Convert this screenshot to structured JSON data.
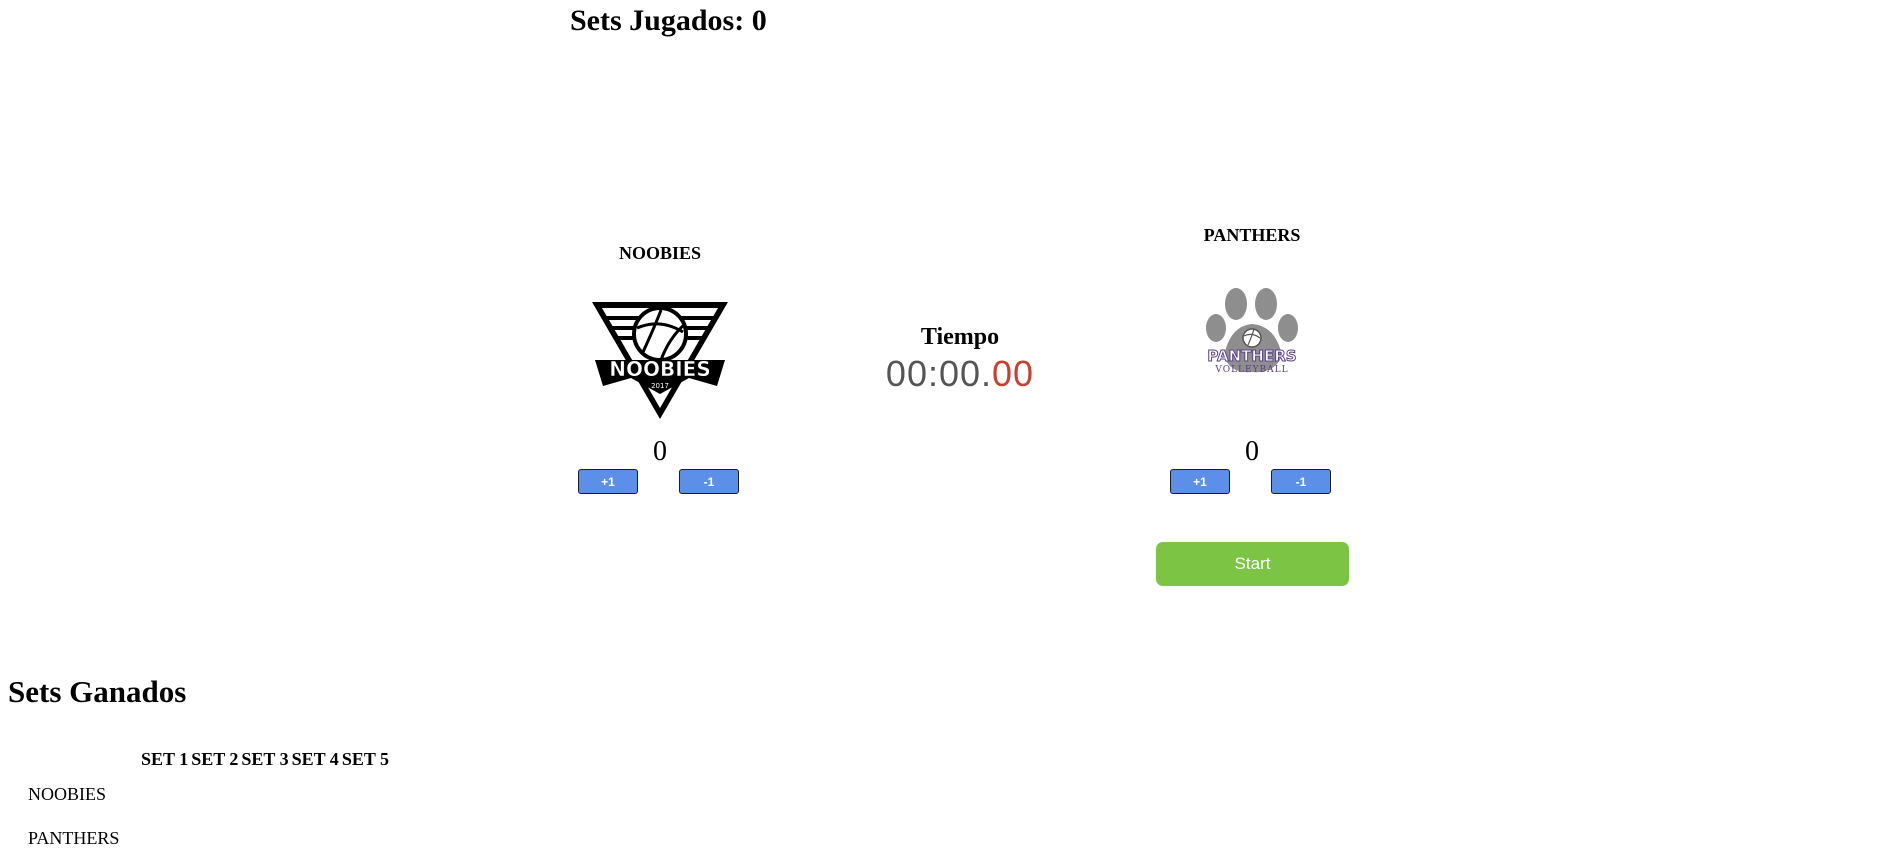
{
  "header": {
    "sets_played_label": "Sets Jugados:",
    "sets_played_value": "0"
  },
  "teams": {
    "left": {
      "name": "NOOBIES",
      "score": "0",
      "logo_text": "NOOBIES",
      "logo_year": "2017",
      "plus_label": "+1",
      "minus_label": "-1",
      "logo_icon": "volleyball-triangle-logo"
    },
    "right": {
      "name": "PANTHERS",
      "score": "0",
      "logo_text": "PANTHERS",
      "logo_subtext": "VOLLEYBALL",
      "plus_label": "+1",
      "minus_label": "-1",
      "logo_icon": "paw-print-logo"
    }
  },
  "timer": {
    "label": "Tiempo",
    "minutes_seconds": "00:00.",
    "hundredths": "00",
    "digit_color": "#555555",
    "hundredths_color": "#c9402f"
  },
  "controls": {
    "start_label": "Start",
    "start_color": "#7cc444",
    "score_button_color": "#5b8fe8"
  },
  "sets_won": {
    "title": "Sets Ganados",
    "columns": [
      "SET 1",
      "SET 2",
      "SET 3",
      "SET 4",
      "SET 5"
    ],
    "rows": [
      {
        "team": "NOOBIES",
        "sets": [
          "",
          "",
          "",
          "",
          ""
        ]
      },
      {
        "team": "PANTHERS",
        "sets": [
          "",
          "",
          "",
          "",
          ""
        ]
      }
    ]
  }
}
